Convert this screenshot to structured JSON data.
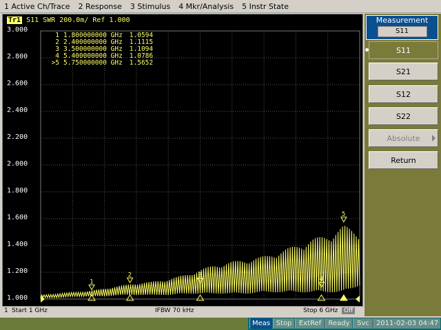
{
  "menu": [
    "1 Active Ch/Trace",
    "2 Response",
    "3 Stimulus",
    "4 Mkr/Analysis",
    "5 Instr State"
  ],
  "trace": {
    "badge": "Tr1",
    "label": "S11 SWR 200.0m/ Ref 1.000"
  },
  "markers": [
    {
      "num": "1",
      "active": false,
      "freq": "1.800000000 GHz",
      "value": "1.0594"
    },
    {
      "num": "2",
      "active": false,
      "freq": "2.400000000 GHz",
      "value": "1.1115"
    },
    {
      "num": "3",
      "active": false,
      "freq": "3.500000000 GHz",
      "value": "1.1094"
    },
    {
      "num": "4",
      "active": false,
      "freq": "5.400000000 GHz",
      "value": "1.0786"
    },
    {
      "num": ">5",
      "active": true,
      "freq": "5.750000000 GHz",
      "value": "1.5652"
    }
  ],
  "footer": {
    "channel": "1",
    "start": "Start 1 GHz",
    "ifbw": "IFBW 70 kHz",
    "stop": "Stop 6 GHz",
    "off": "Off"
  },
  "status": {
    "meas": "Meas",
    "stop": "Stop",
    "extref": "ExtRef",
    "ready": "Ready",
    "svc": "Svc",
    "datetime": "2011-02-03 04:47"
  },
  "softkeys": {
    "title": "Measurement",
    "title_value": "S11",
    "items": [
      {
        "label": "S11",
        "selected": true,
        "disabled": false
      },
      {
        "label": "S21",
        "selected": false,
        "disabled": false
      },
      {
        "label": "S12",
        "selected": false,
        "disabled": false
      },
      {
        "label": "S22",
        "selected": false,
        "disabled": false
      },
      {
        "label": "Absolute",
        "selected": false,
        "disabled": true
      },
      {
        "label": "Return",
        "selected": false,
        "disabled": false
      }
    ]
  },
  "chart_data": {
    "type": "line",
    "x_start_ghz": 1,
    "x_stop_ghz": 6,
    "ylim": [
      1.0,
      3.0
    ],
    "yticks": [
      "3.000",
      "2.800",
      "2.600",
      "2.400",
      "2.200",
      "2.000",
      "1.800",
      "1.600",
      "1.400",
      "1.200",
      "1.000"
    ],
    "grid": true,
    "series": [
      {
        "color": "#ffff66",
        "x": [
          1.0,
          1.25,
          1.5,
          1.75,
          2.0,
          2.25,
          2.5,
          2.75,
          3.0,
          3.25,
          3.5,
          3.75,
          4.0,
          4.25,
          4.5,
          4.75,
          5.0,
          5.25,
          5.5,
          5.75,
          6.0
        ],
        "y": [
          1.03,
          1.04,
          1.05,
          1.06,
          1.08,
          1.1,
          1.12,
          1.13,
          1.15,
          1.18,
          1.22,
          1.26,
          1.28,
          1.3,
          1.32,
          1.36,
          1.4,
          1.45,
          1.48,
          1.55,
          1.5
        ],
        "envelope_low": [
          1.01,
          1.01,
          1.02,
          1.02,
          1.02,
          1.03,
          1.03,
          1.03,
          1.03,
          1.04,
          1.04,
          1.04,
          1.04,
          1.04,
          1.05,
          1.05,
          1.05,
          1.05,
          1.05,
          1.05,
          1.1
        ]
      }
    ],
    "marker_points": [
      {
        "num": "1",
        "x": 1.8,
        "y": 1.0594
      },
      {
        "num": "2",
        "x": 2.4,
        "y": 1.1115
      },
      {
        "num": "3",
        "x": 3.5,
        "y": 1.1094
      },
      {
        "num": "4",
        "x": 5.4,
        "y": 1.0786
      },
      {
        "num": "5",
        "x": 5.75,
        "y": 1.5652
      }
    ]
  }
}
